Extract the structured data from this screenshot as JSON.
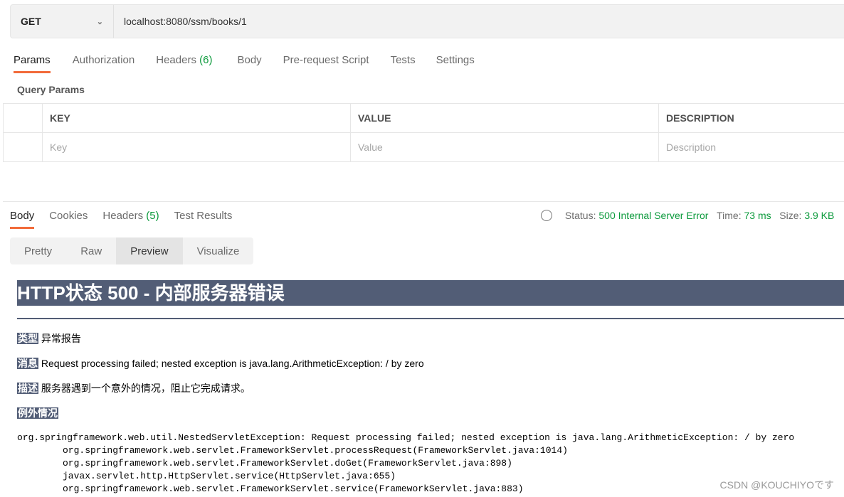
{
  "request": {
    "method": "GET",
    "url": "localhost:8080/ssm/books/1"
  },
  "request_tabs": [
    {
      "label": "Params"
    },
    {
      "label": "Authorization"
    },
    {
      "label": "Headers",
      "count": "(6)"
    },
    {
      "label": "Body"
    },
    {
      "label": "Pre-request Script"
    },
    {
      "label": "Tests"
    },
    {
      "label": "Settings"
    }
  ],
  "query_params": {
    "title": "Query Params",
    "headers": [
      "KEY",
      "VALUE",
      "DESCRIPTION"
    ],
    "placeholders": [
      "Key",
      "Value",
      "Description"
    ]
  },
  "response_tabs": [
    {
      "label": "Body"
    },
    {
      "label": "Cookies"
    },
    {
      "label": "Headers",
      "count": "(5)"
    },
    {
      "label": "Test Results"
    }
  ],
  "status": {
    "status_label": "Status:",
    "status_value": "500 Internal Server Error",
    "time_label": "Time:",
    "time_value": "73 ms",
    "size_label": "Size:",
    "size_value": "3.9 KB"
  },
  "view_modes": [
    "Pretty",
    "Raw",
    "Preview",
    "Visualize"
  ],
  "preview": {
    "title": "HTTP状态 500 - 内部服务器错误",
    "type_label": "类型",
    "type_value": "异常报告",
    "message_label": "消息",
    "message_value": "Request processing failed; nested exception is java.lang.ArithmeticException: / by zero",
    "desc_label": "描述",
    "desc_value": "服务器遇到一个意外的情况，阻止它完成请求。",
    "exception_label": "例外情况",
    "stack": [
      "org.springframework.web.util.NestedServletException: Request processing failed; nested exception is java.lang.ArithmeticException: / by zero",
      "\torg.springframework.web.servlet.FrameworkServlet.processRequest(FrameworkServlet.java:1014)",
      "\torg.springframework.web.servlet.FrameworkServlet.doGet(FrameworkServlet.java:898)",
      "\tjavax.servlet.http.HttpServlet.service(HttpServlet.java:655)",
      "\torg.springframework.web.servlet.FrameworkServlet.service(FrameworkServlet.java:883)"
    ]
  },
  "watermark": "CSDN @KOUCHIYOです"
}
